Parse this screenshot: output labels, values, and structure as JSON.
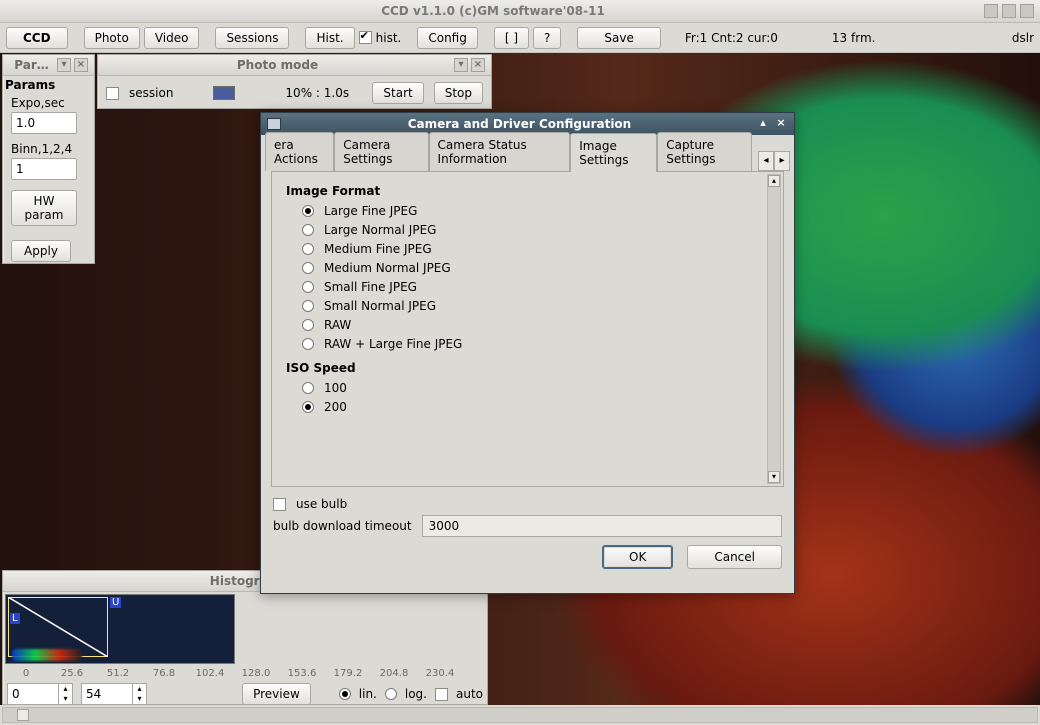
{
  "app": {
    "title": "CCD v1.1.0 (c)GM software'08-11"
  },
  "toolbar": {
    "ccd": "CCD",
    "photo": "Photo",
    "video": "Video",
    "sessions": "Sessions",
    "hist_btn": "Hist.",
    "hist_chk_label": "hist.",
    "config": "Config",
    "layout": "[ ]",
    "help": "?",
    "save": "Save",
    "status": "Fr:1 Cnt:2 cur:0",
    "frm": "13 frm.",
    "mode": "dslr"
  },
  "params": {
    "panel_title": "Params",
    "tab_title": "Par…",
    "expo_label": "Expo,sec",
    "expo_value": "1.0",
    "binn_label": "Binn,1,2,4",
    "binn_value": "1",
    "hw_btn": "HW param",
    "apply_btn": "Apply"
  },
  "photomode": {
    "title": "Photo mode",
    "session_label": "session",
    "progress_text": "10% : 1.0s",
    "start": "Start",
    "stop": "Stop"
  },
  "dialog": {
    "title": "Camera and Driver Configuration",
    "tabs": [
      "era Actions",
      "Camera Settings",
      "Camera Status Information",
      "Image Settings",
      "Capture Settings"
    ],
    "section1": "Image Format",
    "formats": [
      "Large Fine JPEG",
      "Large Normal JPEG",
      "Medium Fine JPEG",
      "Medium Normal JPEG",
      "Small Fine JPEG",
      "Small Normal JPEG",
      "RAW",
      "RAW + Large Fine JPEG"
    ],
    "section2": "ISO Speed",
    "iso": [
      "100",
      "200"
    ],
    "use_bulb": "use bulb",
    "bulb_label": "bulb download timeout",
    "bulb_value": "3000",
    "ok": "OK",
    "cancel": "Cancel"
  },
  "histogram": {
    "title": "Histogram",
    "ticks": [
      "0",
      "25.6",
      "51.2",
      "76.8",
      "102.4",
      "128.0",
      "153.6",
      "179.2",
      "204.8",
      "230.4"
    ],
    "spin0": "0",
    "spin1": "54",
    "preview": "Preview",
    "modes": {
      "lin": "lin.",
      "log": "log.",
      "auto": "auto"
    },
    "L": "L",
    "U": "U"
  }
}
